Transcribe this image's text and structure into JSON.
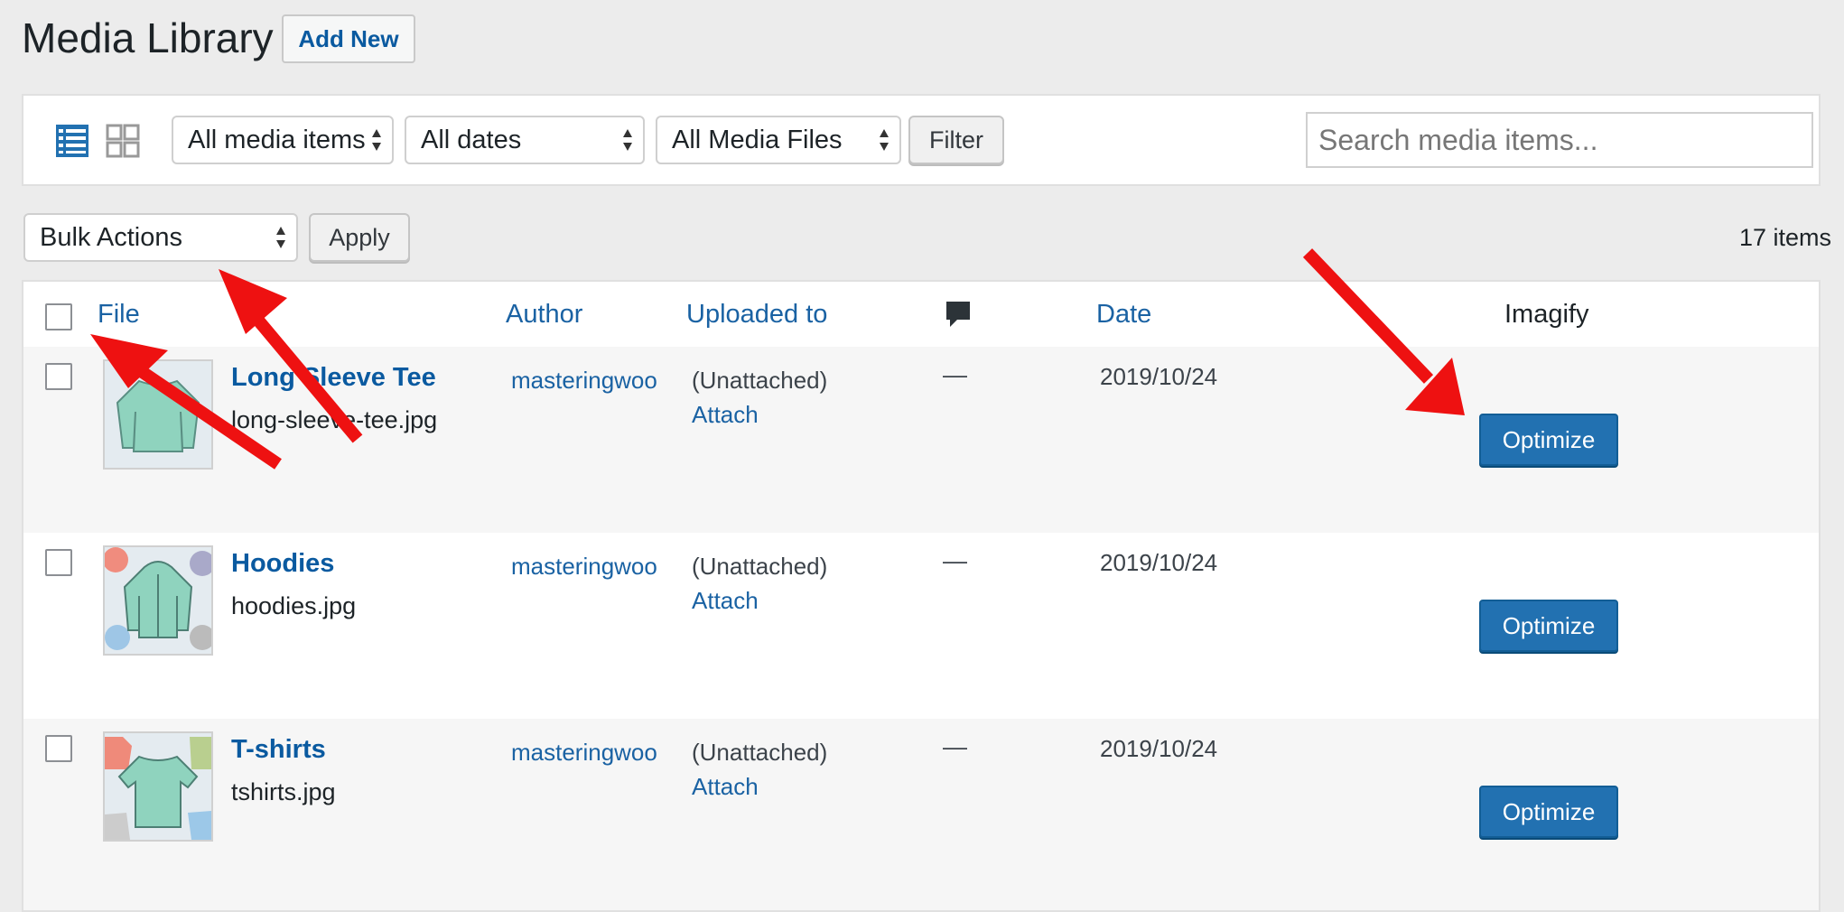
{
  "header": {
    "title": "Media Library",
    "add_new_label": "Add New"
  },
  "filter_bar": {
    "media_type": "All media items",
    "dates": "All dates",
    "imagify_filter": "All Media Files",
    "filter_label": "Filter",
    "search_placeholder": "Search media items..."
  },
  "bulk": {
    "selected": "Bulk Actions",
    "apply_label": "Apply"
  },
  "items_count": "17 items",
  "table": {
    "columns": {
      "file": "File",
      "author": "Author",
      "uploaded_to": "Uploaded to",
      "date": "Date",
      "imagify": "Imagify"
    },
    "rows": [
      {
        "title": "Long Sleeve Tee",
        "filename": "long-sleeve-tee.jpg",
        "author": "masteringwoo",
        "uploaded": "(Unattached)",
        "attach": "Attach",
        "comments": "—",
        "date": "2019/10/24",
        "action": "Optimize"
      },
      {
        "title": "Hoodies",
        "filename": "hoodies.jpg",
        "author": "masteringwoo",
        "uploaded": "(Unattached)",
        "attach": "Attach",
        "comments": "—",
        "date": "2019/10/24",
        "action": "Optimize"
      },
      {
        "title": "T-shirts",
        "filename": "tshirts.jpg",
        "author": "masteringwoo",
        "uploaded": "(Unattached)",
        "attach": "Attach",
        "comments": "—",
        "date": "2019/10/24",
        "action": "Optimize"
      }
    ]
  },
  "colors": {
    "accent": "#2271b1",
    "link": "#1a62a3",
    "arrow": "#ee1111"
  },
  "icons": {
    "list_view": "list-view-icon",
    "grid_view": "grid-view-icon",
    "comments": "comment-bubble-icon"
  }
}
